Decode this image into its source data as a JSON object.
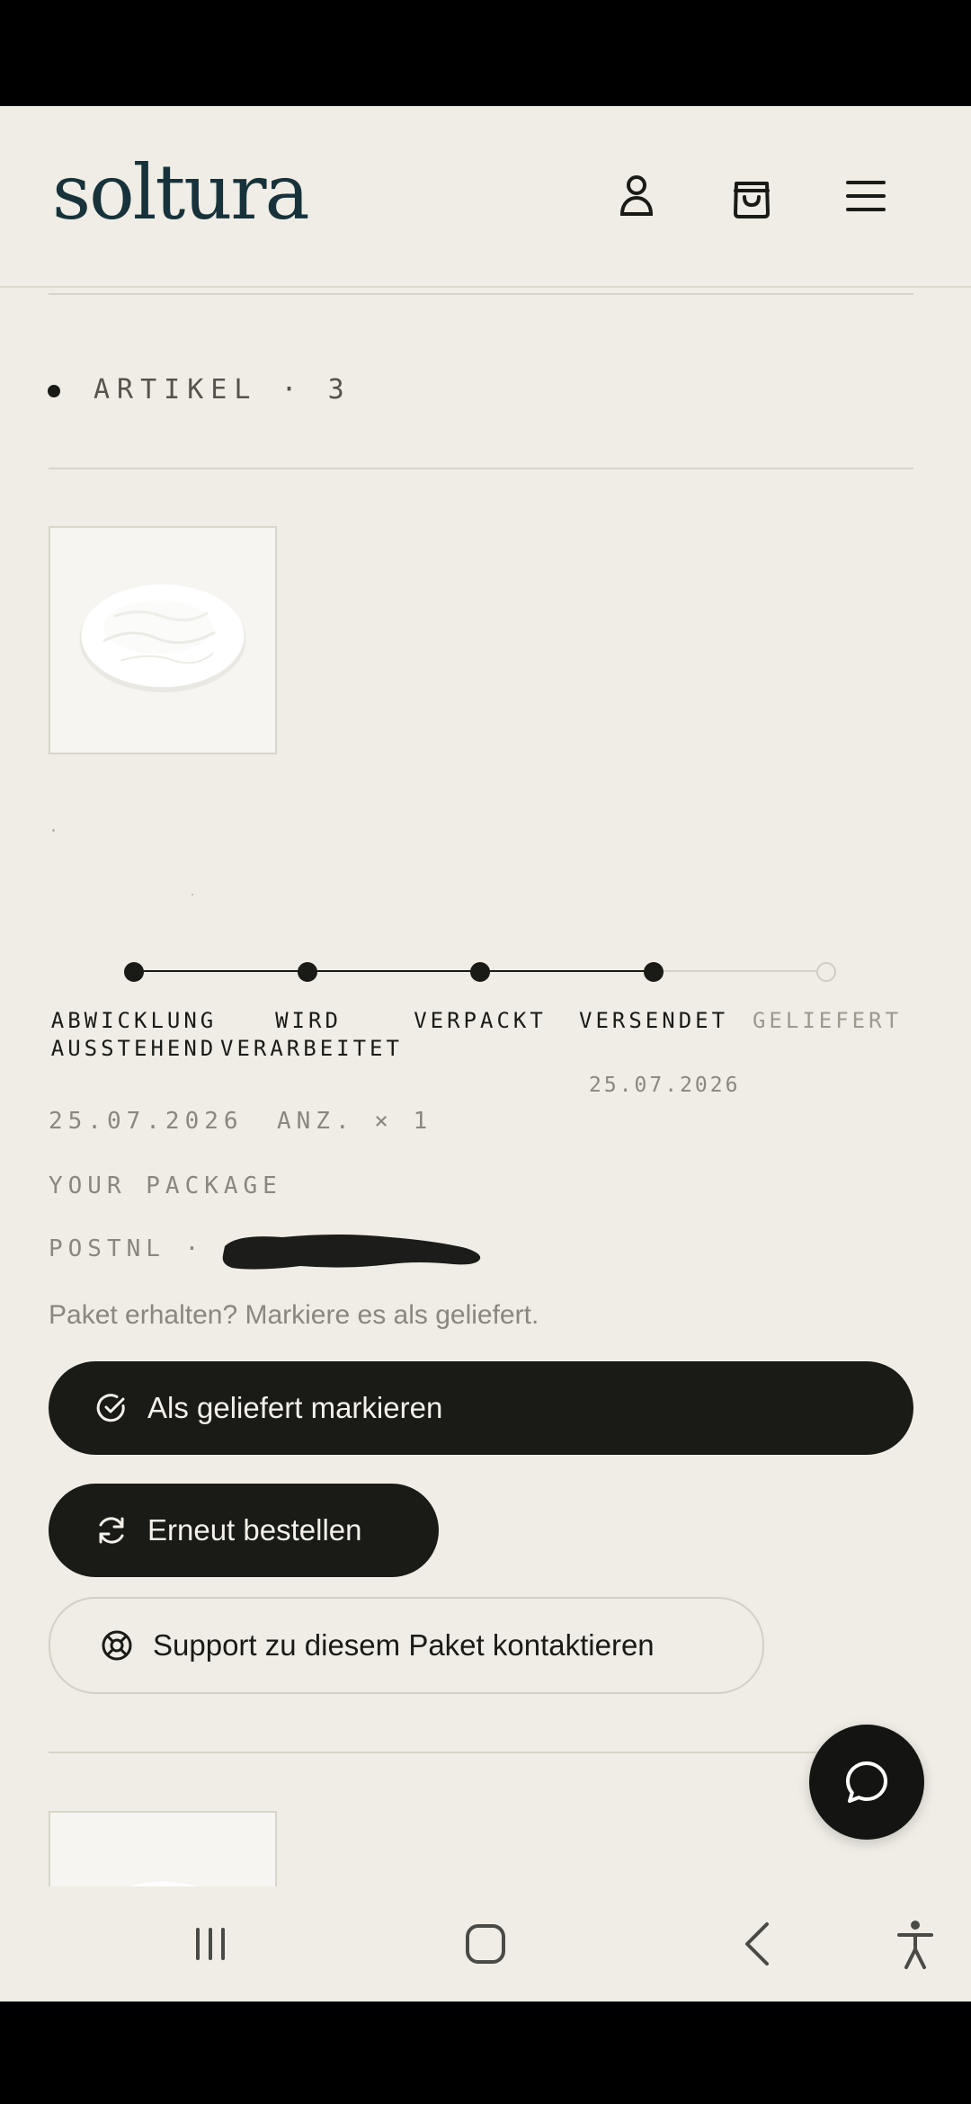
{
  "header": {
    "logo": "soltura",
    "icons": [
      "account-icon",
      "shopping-bag-icon",
      "menu-icon"
    ]
  },
  "section": {
    "label": "ARTIKEL · 3"
  },
  "item": {
    "stray_mark": ".",
    "timeline": {
      "steps": [
        {
          "label": "ABWICKLUNG\nAUSSTEHEND",
          "state": "done"
        },
        {
          "label": "WIRD\nVERARBEITET",
          "state": "done"
        },
        {
          "label": "VERPACKT",
          "state": "done"
        },
        {
          "label": "VERSENDET",
          "state": "done",
          "date": "25.07.2026"
        },
        {
          "label": "GELIEFERT",
          "state": "pending"
        }
      ]
    },
    "order_date": "25.07.2026",
    "quantity": "ANZ. × 1",
    "package_name": "YOUR PACKAGE",
    "carrier": "POSTNL ·",
    "received_hint": "Paket erhalten? Markiere es als geliefert.",
    "actions": {
      "mark_delivered": "Als geliefert markieren",
      "reorder": "Erneut bestellen",
      "support": "Support zu diesem Paket kontaktieren"
    }
  },
  "colors": {
    "background": "#efede5",
    "primary_dark": "#1a1a16",
    "logo": "#17323a",
    "muted_text": "#8a877e",
    "divider": "#d8d5c9"
  },
  "chat": {
    "icon": "chat-bubble-icon"
  },
  "system_nav": {
    "icons": [
      "recent-apps-icon",
      "home-icon",
      "back-icon",
      "accessibility-icon"
    ]
  }
}
